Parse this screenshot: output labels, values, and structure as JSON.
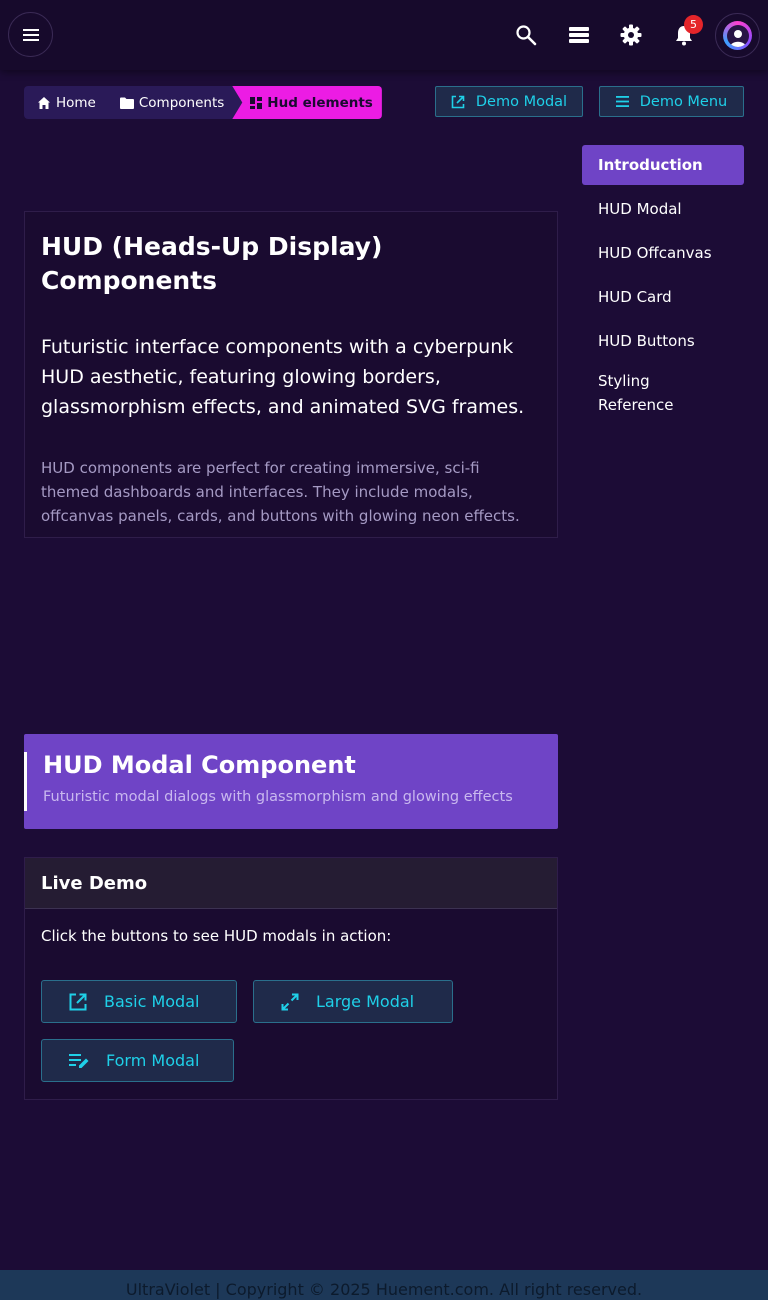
{
  "topbar": {
    "icons": [
      "menu-icon",
      "search-icon",
      "layers-icon",
      "gear-icon",
      "bell-icon",
      "avatar"
    ],
    "notification_count": "5"
  },
  "breadcrumb": {
    "items": [
      "Home",
      "Components",
      "Hud elements"
    ]
  },
  "header_actions": {
    "demo_modal": "Demo Modal",
    "demo_menu": "Demo Menu"
  },
  "sidenav": {
    "items": [
      "Introduction",
      "HUD Modal",
      "HUD Offcanvas",
      "HUD Card",
      "HUD Buttons",
      "Styling Reference"
    ]
  },
  "intro": {
    "title": "HUD (Heads-Up Display) Components",
    "lead": "Futuristic interface components with a cyberpunk HUD aesthetic, featuring glowing borders, glassmorphism effects, and animated SVG frames.",
    "body": "HUD components are perfect for creating immersive, sci-fi themed dashboards and interfaces. They include modals, offcanvas panels, cards, and buttons with glowing neon effects."
  },
  "modal_section": {
    "title": "HUD Modal Component",
    "subtitle": "Futuristic modal dialogs with glassmorphism and glowing effects"
  },
  "demo": {
    "title": "Live Demo",
    "text": "Click the buttons to see HUD modals in action:",
    "buttons": [
      "Basic Modal",
      "Large Modal",
      "Form Modal"
    ]
  },
  "footer": {
    "text": "UltraViolet | Copyright © 2025 Huement.com. All right reserved."
  },
  "colors": {
    "background": "#1c0c36",
    "accent": "#6f44c6",
    "hud_cyan": "#1fd0e8",
    "magenta": "#ec1ce4"
  }
}
